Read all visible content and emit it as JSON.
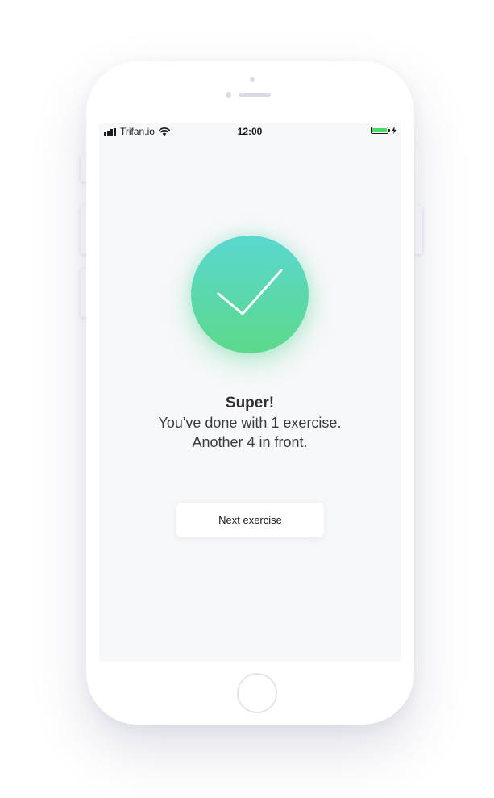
{
  "status_bar": {
    "carrier": "Trifan.io",
    "time": "12:00",
    "signal_icon": "signal-bars-icon",
    "wifi_icon": "wifi-icon",
    "battery_icon": "battery-full-icon",
    "charging_icon": "lightning-bolt-icon",
    "battery_level": 1.0,
    "battery_color": "#4cd964"
  },
  "success": {
    "icon": "checkmark-icon",
    "gradient_top": "#5ad8d0",
    "gradient_bottom": "#5cd98a",
    "title": "Super!",
    "line1": "You've done with 1 exercise.",
    "line2": "Another 4 in front."
  },
  "actions": {
    "next_label": "Next exercise"
  },
  "colors": {
    "screen_background": "#f7f8fa",
    "text": "#3a3a3f"
  }
}
